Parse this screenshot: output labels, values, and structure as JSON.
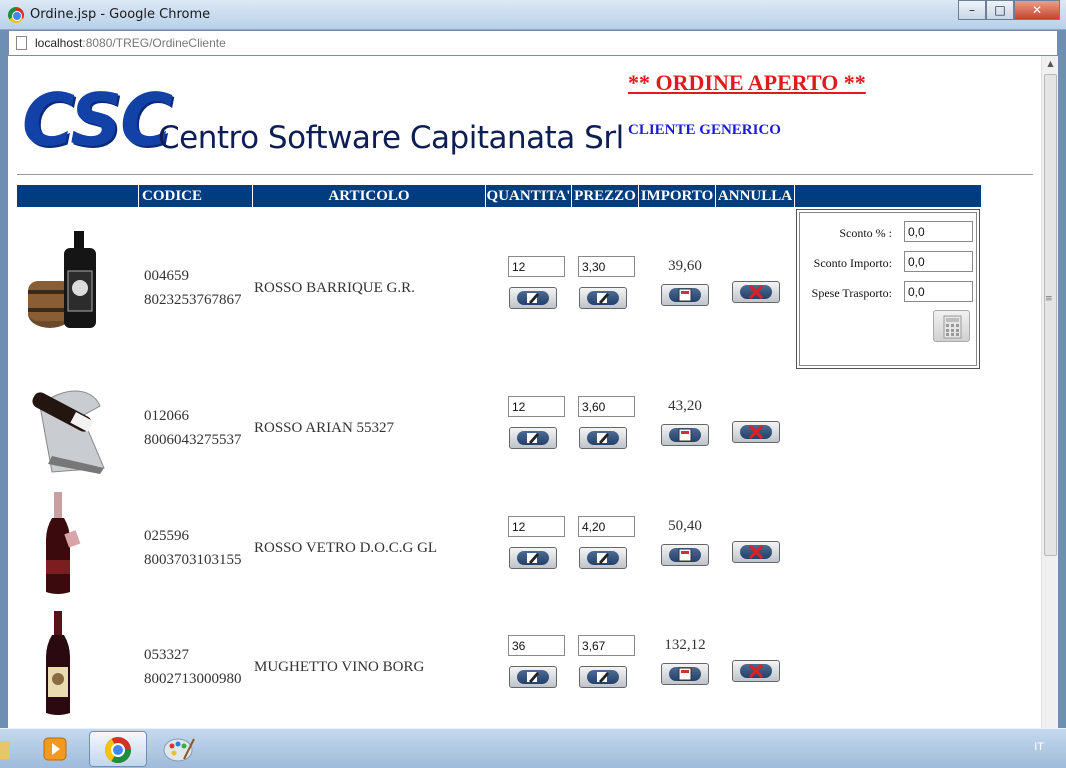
{
  "window": {
    "title": "Ordine.jsp - Google Chrome",
    "url_host": "localhost",
    "url_rest": ":8080/TREG/OrdineCliente"
  },
  "header": {
    "logo_text": "CSC",
    "company_name": "Centro Software Capitanata Srl",
    "order_status": "** ORDINE APERTO **",
    "client": "CLIENTE GENERICO"
  },
  "table": {
    "columns": {
      "code": "CODICE",
      "article": "ARTICOLO",
      "quantity": "QUANTITA'",
      "price": "PREZZO",
      "amount": "IMPORTO",
      "cancel": "ANNULLA"
    },
    "rows": [
      {
        "code": "004659",
        "barcode": "8023253767867",
        "article": "ROSSO BARRIQUE G.R.",
        "quantity": "12",
        "price": "3,30",
        "amount": "39,60"
      },
      {
        "code": "012066",
        "barcode": "8006043275537",
        "article": "ROSSO ARIAN 55327",
        "quantity": "12",
        "price": "3,60",
        "amount": "43,20"
      },
      {
        "code": "025596",
        "barcode": "8003703103155",
        "article": "ROSSO VETRO D.O.C.G GL",
        "quantity": "12",
        "price": "4,20",
        "amount": "50,40"
      },
      {
        "code": "053327",
        "barcode": "8002713000980",
        "article": "MUGHETTO VINO BORG",
        "quantity": "36",
        "price": "3,67",
        "amount": "132,12"
      }
    ]
  },
  "discounts": {
    "percent_label": "Sconto % :",
    "percent_value": "0,0",
    "amount_label": "Sconto Importo:",
    "amount_value": "0,0",
    "shipping_label": "Spese Trasporto:",
    "shipping_value": "0,0"
  },
  "taskbar": {
    "language": "IT"
  },
  "colors": {
    "table_header": "#003d80",
    "status_red": "#e01b1b",
    "client_blue": "#1b1bd6",
    "logo_blue": "#1241a8"
  }
}
